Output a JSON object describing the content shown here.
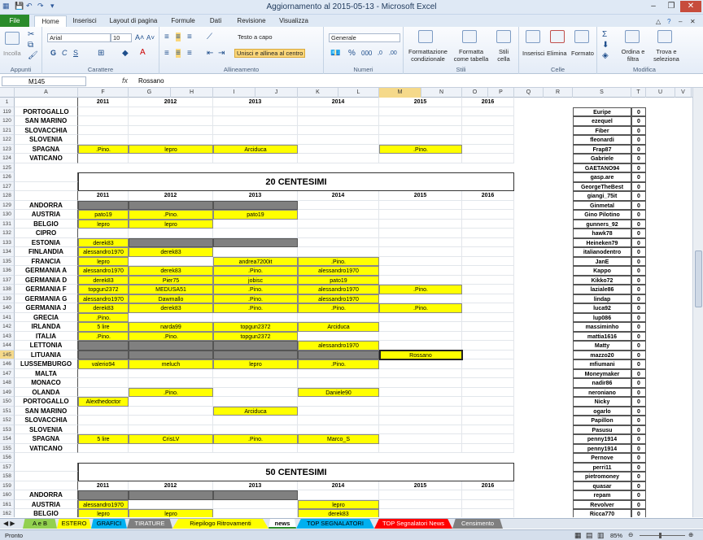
{
  "title": "Aggiornamento al 2015-05-13 - Microsoft Excel",
  "tabs": [
    "File",
    "Home",
    "Inserisci",
    "Layout di pagina",
    "Formule",
    "Dati",
    "Revisione",
    "Visualizza"
  ],
  "ribbon": {
    "incolla": "Incolla",
    "appunti": "Appunti",
    "font_name": "Arial",
    "font_size": "10",
    "carattere": "Carattere",
    "testo_a_capo": "Testo a capo",
    "unisci": "Unisci e allinea al centro",
    "allineamento": "Allineamento",
    "number_format": "Generale",
    "numeri": "Numeri",
    "cond_format": "Formattazione condizionale",
    "format_table": "Formatta come tabella",
    "cell_styles": "Stili cella",
    "stili": "Stili",
    "insert": "Inserisci",
    "delete": "Elimina",
    "format": "Formato",
    "celle": "Celle",
    "sort": "Ordina e filtra",
    "find": "Trova e seleziona",
    "modifica": "Modifica"
  },
  "formula": {
    "name_box": "M145",
    "fx": "fx",
    "value": "Rossano"
  },
  "columns": [
    "A",
    "F",
    "G",
    "H",
    "I",
    "J",
    "K",
    "L",
    "M",
    "N",
    "O",
    "P",
    "Q",
    "R",
    "S",
    "T",
    "U",
    "V"
  ],
  "year_headers": [
    "2011",
    "2012",
    "2013",
    "2014",
    "2015",
    "2016"
  ],
  "section_titles": [
    "20 CENTESIMI",
    "50 CENTESIMI"
  ],
  "rows": [
    {
      "n": "1",
      "type": "years"
    },
    {
      "n": "119",
      "name": "PORTOGALLO",
      "c": [
        "",
        "",
        "",
        "",
        ""
      ]
    },
    {
      "n": "120",
      "name": "SAN MARINO",
      "c": [
        "",
        "",
        "",
        "",
        ""
      ]
    },
    {
      "n": "121",
      "name": "SLOVACCHIA",
      "c": [
        "",
        "",
        "",
        "",
        ""
      ]
    },
    {
      "n": "122",
      "name": "SLOVENIA",
      "c": [
        "",
        "",
        "",
        "",
        ""
      ]
    },
    {
      "n": "123",
      "name": "SPAGNA",
      "c": [
        ".Pino.",
        "lepro",
        "Arciduca",
        "",
        ".Pino."
      ]
    },
    {
      "n": "124",
      "name": "VATICANO",
      "c": [
        "",
        "",
        "",
        "",
        ""
      ]
    },
    {
      "n": "125",
      "type": "blank"
    },
    {
      "n": "126",
      "type": "title1"
    },
    {
      "n": "127",
      "type": "title1b"
    },
    {
      "n": "128",
      "type": "years"
    },
    {
      "n": "129",
      "name": "ANDORRA",
      "c": [
        "G",
        "G",
        "G",
        "",
        ""
      ]
    },
    {
      "n": "130",
      "name": "AUSTRIA",
      "c": [
        "pato19",
        ".Pino.",
        "pato19",
        "",
        ""
      ]
    },
    {
      "n": "131",
      "name": "BELGIO",
      "c": [
        "lepro",
        "lepro",
        "",
        "",
        ""
      ]
    },
    {
      "n": "132",
      "name": "CIPRO",
      "c": [
        "",
        "",
        "",
        "",
        ""
      ]
    },
    {
      "n": "133",
      "name": "ESTONIA",
      "c": [
        "derek83",
        "G",
        "G",
        "",
        ""
      ]
    },
    {
      "n": "134",
      "name": "FINLANDIA",
      "c": [
        "alessandro1970",
        "derek83",
        "",
        "",
        ""
      ]
    },
    {
      "n": "135",
      "name": "FRANCIA",
      "c": [
        "lepro",
        "",
        "andrea7200it",
        ".Pino.",
        ""
      ]
    },
    {
      "n": "136",
      "name": "GERMANIA A",
      "c": [
        "alessandro1970",
        "derek83",
        ".Pino.",
        "alessandro1970",
        ""
      ]
    },
    {
      "n": "137",
      "name": "GERMANIA D",
      "c": [
        "derek83",
        "Pier75",
        "jobisc",
        "pato19",
        ""
      ]
    },
    {
      "n": "138",
      "name": "GERMANIA F",
      "c": [
        "topgun2372",
        "MEDUSA51",
        ".Pino.",
        "alessandro1970",
        ".Pino."
      ]
    },
    {
      "n": "139",
      "name": "GERMANIA G",
      "c": [
        "alessandro1970",
        "Dawmallo",
        ".Pino.",
        "alessandro1970",
        ""
      ]
    },
    {
      "n": "140",
      "name": "GERMANIA J",
      "c": [
        "derek83",
        "derek83",
        ".Pino.",
        ".Pino.",
        ".Pino."
      ]
    },
    {
      "n": "141",
      "name": "GRECIA",
      "c": [
        ".Pino.",
        "",
        "",
        "",
        ""
      ]
    },
    {
      "n": "142",
      "name": "IRLANDA",
      "c": [
        "5 lire",
        "narda99",
        "topgun2372",
        "Arciduca",
        ""
      ]
    },
    {
      "n": "143",
      "name": "ITALIA",
      "c": [
        ".Pino.",
        ".Pino.",
        "topgun2372",
        "",
        ""
      ]
    },
    {
      "n": "144",
      "name": "LETTONIA",
      "c": [
        "G",
        "G",
        "G",
        "alessandro1970",
        ""
      ]
    },
    {
      "n": "145",
      "name": "LITUANIA",
      "c": [
        "G",
        "G",
        "G",
        "G",
        "Rossano"
      ]
    },
    {
      "n": "146",
      "name": "LUSSEMBURGO",
      "c": [
        "valerio94",
        "meluch",
        "lepro",
        ".Pino.",
        ""
      ]
    },
    {
      "n": "147",
      "name": "MALTA",
      "c": [
        "",
        "",
        "",
        "",
        ""
      ]
    },
    {
      "n": "148",
      "name": "MONACO",
      "c": [
        "",
        "",
        "",
        "",
        ""
      ]
    },
    {
      "n": "149",
      "name": "OLANDA",
      "c": [
        "",
        ".Pino.",
        "",
        "Daniele90",
        ""
      ]
    },
    {
      "n": "150",
      "name": "PORTOGALLO",
      "c": [
        "Alexthedoctor",
        "",
        "",
        "",
        ""
      ]
    },
    {
      "n": "151",
      "name": "SAN MARINO",
      "c": [
        "",
        "",
        "Arciduca",
        "",
        ""
      ]
    },
    {
      "n": "152",
      "name": "SLOVACCHIA",
      "c": [
        "",
        "",
        "",
        "",
        ""
      ]
    },
    {
      "n": "153",
      "name": "SLOVENIA",
      "c": [
        "",
        "",
        "",
        "",
        ""
      ]
    },
    {
      "n": "154",
      "name": "SPAGNA",
      "c": [
        "5 lire",
        "CrisLV",
        ".Pino.",
        "Marco_S",
        ""
      ]
    },
    {
      "n": "155",
      "name": "VATICANO",
      "c": [
        "",
        "",
        "",
        "",
        ""
      ]
    },
    {
      "n": "156",
      "type": "blank"
    },
    {
      "n": "157",
      "type": "title2"
    },
    {
      "n": "158",
      "type": "title2b"
    },
    {
      "n": "159",
      "type": "years"
    },
    {
      "n": "160",
      "name": "ANDORRA",
      "c": [
        "G",
        "G",
        "G",
        "",
        ""
      ]
    },
    {
      "n": "161",
      "name": "AUSTRIA",
      "c": [
        "alessandro1970",
        "",
        "",
        "lepro",
        ""
      ]
    },
    {
      "n": "162",
      "name": "BELGIO",
      "c": [
        "lepro",
        "lepro",
        "",
        "derek83",
        ""
      ]
    }
  ],
  "users": [
    {
      "name": "Euripe",
      "v": "0"
    },
    {
      "name": "ezequel",
      "v": "0"
    },
    {
      "name": "Fiber",
      "v": "0"
    },
    {
      "name": "fleonardi",
      "v": "0"
    },
    {
      "name": "Frap87",
      "v": "0"
    },
    {
      "name": "Gabriele",
      "v": "0"
    },
    {
      "name": "GAETANO94",
      "v": "0"
    },
    {
      "name": "gasp.are",
      "v": "0"
    },
    {
      "name": "GeorgeTheBest",
      "v": "0"
    },
    {
      "name": "giangi_75it",
      "v": "0"
    },
    {
      "name": "Ginmetal",
      "v": "0"
    },
    {
      "name": "Gino Pilotino",
      "v": "0"
    },
    {
      "name": "gunners_92",
      "v": "0"
    },
    {
      "name": "hawk78",
      "v": "0"
    },
    {
      "name": "Heineken79",
      "v": "0"
    },
    {
      "name": "italianodentro",
      "v": "0"
    },
    {
      "name": "JanE",
      "v": "0"
    },
    {
      "name": "Kappo",
      "v": "0"
    },
    {
      "name": "Kikko72",
      "v": "0"
    },
    {
      "name": "laziale86",
      "v": "0"
    },
    {
      "name": "lindap",
      "v": "0"
    },
    {
      "name": "luca92",
      "v": "0"
    },
    {
      "name": "lup086",
      "v": "0"
    },
    {
      "name": "massiminho",
      "v": "0"
    },
    {
      "name": "mattia1616",
      "v": "0"
    },
    {
      "name": "Matty",
      "v": "0"
    },
    {
      "name": "mazzo20",
      "v": "0"
    },
    {
      "name": "mfiumani",
      "v": "0"
    },
    {
      "name": "Moneymaker",
      "v": "0"
    },
    {
      "name": "nadir86",
      "v": "0"
    },
    {
      "name": "neroniano",
      "v": "0"
    },
    {
      "name": "Nicky",
      "v": "0"
    },
    {
      "name": "ogarlo",
      "v": "0"
    },
    {
      "name": "Papillon",
      "v": "0"
    },
    {
      "name": "Pasusu",
      "v": "0"
    },
    {
      "name": "penny1914",
      "v": "0"
    },
    {
      "name": "penny1914",
      "v": "0"
    },
    {
      "name": "Pernove",
      "v": "0"
    },
    {
      "name": "perri11",
      "v": "0"
    },
    {
      "name": "pietromoney",
      "v": "0"
    },
    {
      "name": "quasar",
      "v": "0"
    },
    {
      "name": "repam",
      "v": "0"
    },
    {
      "name": "Revolver",
      "v": "0"
    },
    {
      "name": "Ricca770",
      "v": "0"
    }
  ],
  "sheet_tabs": [
    {
      "label": "A e B",
      "color": "#92d050"
    },
    {
      "label": "ESTERO",
      "color": "#ffff00"
    },
    {
      "label": "GRAFICI",
      "color": "#00b0f0"
    },
    {
      "label": "TIRATURE",
      "color": "#7f7f7f"
    },
    {
      "label": "Riepilogo Ritrovamenti",
      "color": "#ffff00"
    },
    {
      "label": "news",
      "color": "#ffffff"
    },
    {
      "label": "TOP SEGNALATORI",
      "color": "#00b0f0"
    },
    {
      "label": "TOP Segnalatori News",
      "color": "#ff0000"
    },
    {
      "label": "Censimento",
      "color": "#7f7f7f"
    }
  ],
  "status": {
    "mode": "Pronto",
    "zoom": "85%"
  }
}
